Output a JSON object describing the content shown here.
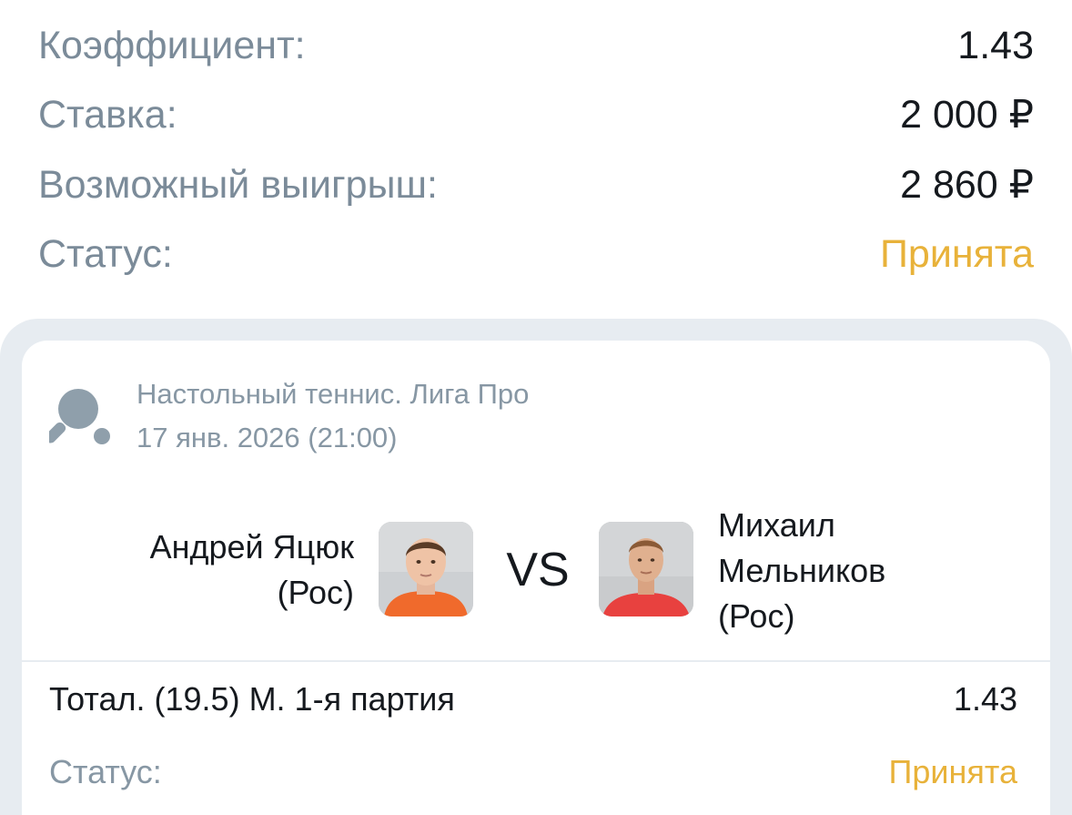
{
  "summary": {
    "coef_label": "Коэффициент:",
    "coef_value": "1.43",
    "stake_label": "Ставка:",
    "stake_value": "2 000 ₽",
    "win_label": "Возможный выигрыш:",
    "win_value": "2 860 ₽",
    "status_label": "Статус:",
    "status_value": "Принята"
  },
  "event": {
    "sport_icon": "table-tennis-icon",
    "league": "Настольный теннис. Лига Про",
    "date": "17 янв. 2026 (21:00)",
    "player1_line1": "Андрей Яцюк",
    "player1_line2": "(Рос)",
    "player2_line1": "Михаил",
    "player2_line2": "Мельников",
    "player2_line3": "(Рос)",
    "vs": "VS"
  },
  "bet": {
    "market": "Тотал. (19.5) М. 1-я партия",
    "odds": "1.43",
    "status_label": "Статус:",
    "status_value": "Принята"
  },
  "colors": {
    "label_grey": "#7b8b99",
    "text_dark": "#15191e",
    "status_accepted": "#e8b23a",
    "card_frame": "#e7ecf1"
  }
}
